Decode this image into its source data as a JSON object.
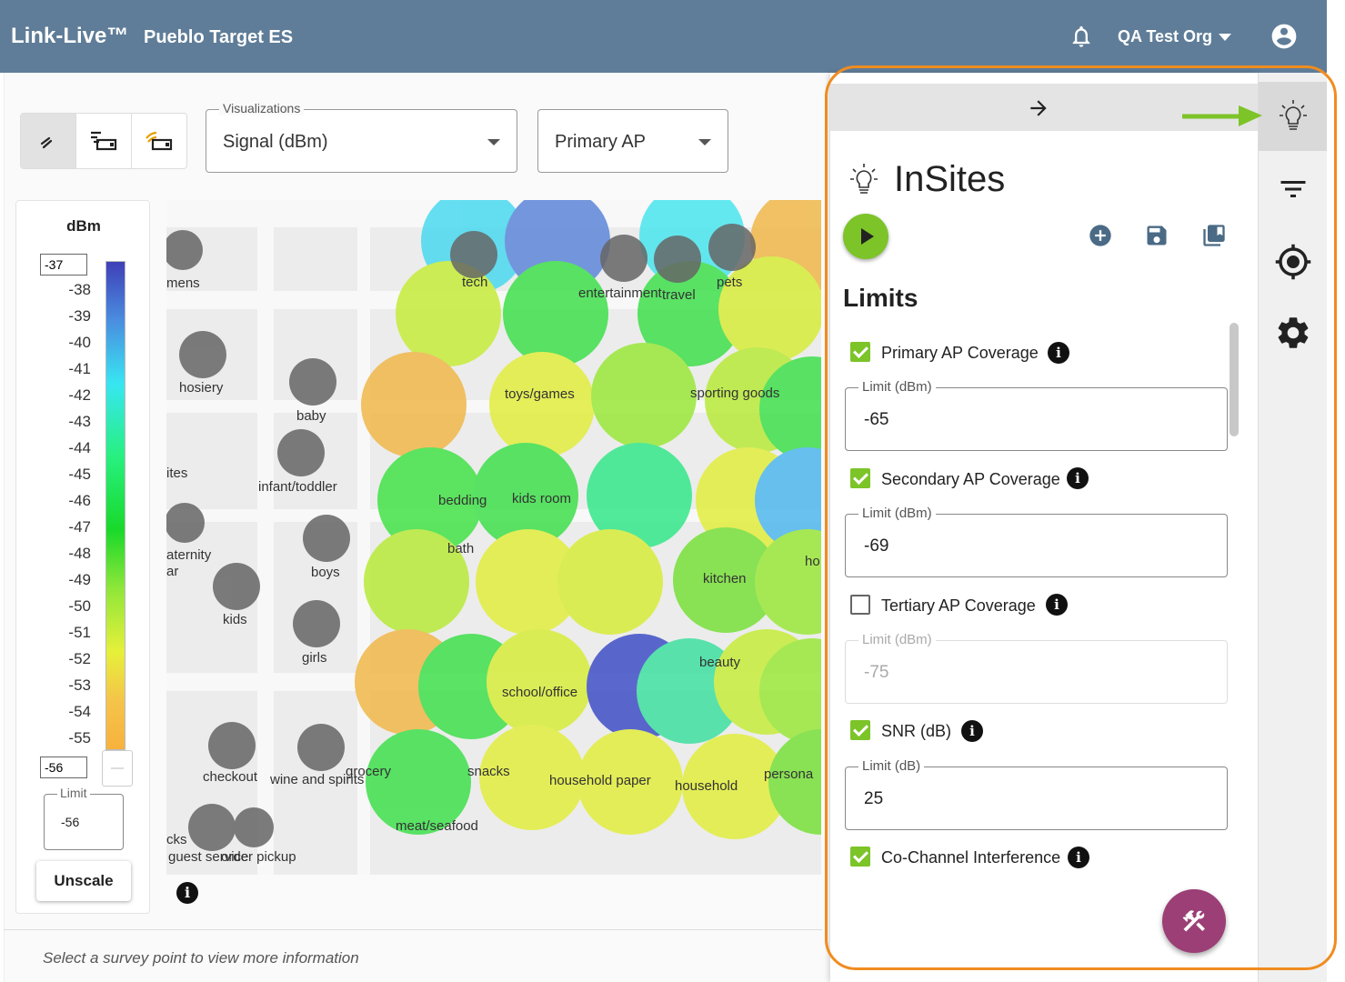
{
  "header": {
    "brand": "Link-Live™",
    "site": "Pueblo Target ES",
    "org": "QA Test Org"
  },
  "controls": {
    "visualizations_label": "Visualizations",
    "visualization_value": "Signal (dBm)",
    "ap_value": "Primary AP"
  },
  "legend": {
    "title": "dBm",
    "max_input": "-37",
    "min_input": "-56",
    "scale": [
      "-38",
      "-39",
      "-40",
      "-41",
      "-42",
      "-43",
      "-44",
      "-45",
      "-46",
      "-47",
      "-48",
      "-49",
      "-50",
      "-51",
      "-52",
      "-53",
      "-54",
      "-55"
    ],
    "limit_label": "Limit",
    "limit_value": "-56",
    "unscale_label": "Unscale"
  },
  "map": {
    "departments": [
      "mens",
      "tech",
      "entertainment",
      "travel",
      "pets",
      "hosiery",
      "baby",
      "toys/games",
      "sporting goods",
      "ites",
      "infant/toddler",
      "bedding",
      "kids room",
      "bath",
      "aternity",
      "ar",
      "boys",
      "kitchen",
      "ho",
      "kids",
      "girls",
      "beauty",
      "school/office",
      "checkout",
      "wine and spirits",
      "grocery",
      "snacks",
      "household paper",
      "household",
      "persona",
      "cks",
      "meat/seafood",
      "guest service",
      "order pickup"
    ]
  },
  "footer": {
    "hint": "Select a survey point to view more information"
  },
  "insites": {
    "title": "InSites",
    "limits_title": "Limits",
    "limits": [
      {
        "label": "Primary AP Coverage",
        "checked": true,
        "field_label": "Limit (dBm)",
        "value": "-65"
      },
      {
        "label": "Secondary AP Coverage",
        "checked": true,
        "field_label": "Limit (dBm)",
        "value": "-69"
      },
      {
        "label": "Tertiary AP Coverage",
        "checked": false,
        "field_label": "Limit (dBm)",
        "value": "-75"
      },
      {
        "label": "SNR (dB)",
        "checked": true,
        "field_label": "Limit (dB)",
        "value": "25"
      },
      {
        "label": "Co-Channel Interference",
        "checked": true
      }
    ]
  },
  "colors": {
    "topbar": "#5f7d98",
    "accent_green": "#7cc428",
    "fab": "#9b3f76",
    "highlight": "#f08c1f"
  }
}
